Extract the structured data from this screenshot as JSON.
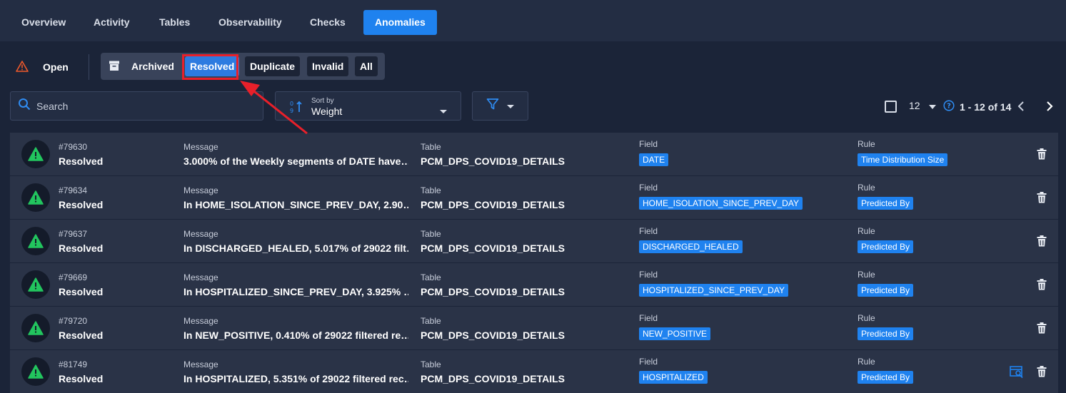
{
  "tabs": [
    {
      "label": "Overview",
      "active": false
    },
    {
      "label": "Activity",
      "active": false
    },
    {
      "label": "Tables",
      "active": false
    },
    {
      "label": "Observability",
      "active": false
    },
    {
      "label": "Checks",
      "active": false
    },
    {
      "label": "Anomalies",
      "active": true
    }
  ],
  "status_filter": {
    "open_label": "Open",
    "open_icon": "warning-triangle-outline-icon",
    "archived_label": "Archived",
    "archived_icon": "archive-box-icon",
    "options": [
      "Resolved",
      "Duplicate",
      "Invalid",
      "All"
    ],
    "selected": "Resolved"
  },
  "search": {
    "placeholder": "Search"
  },
  "sort": {
    "label": "Sort by",
    "value": "Weight"
  },
  "pagination": {
    "page_size": "12",
    "range": "1 - 12 of 14"
  },
  "columns": {
    "message": "Message",
    "table": "Table",
    "field": "Field",
    "rule": "Rule"
  },
  "rows": [
    {
      "id": "#79630",
      "status": "Resolved",
      "message": "3.000% of the Weekly segments of DATE have…",
      "table": "PCM_DPS_COVID19_DETAILS",
      "field": "DATE",
      "rule": "Time Distribution Size",
      "inspect": false
    },
    {
      "id": "#79634",
      "status": "Resolved",
      "message": "In HOME_ISOLATION_SINCE_PREV_DAY, 2.90…",
      "table": "PCM_DPS_COVID19_DETAILS",
      "field": "HOME_ISOLATION_SINCE_PREV_DAY",
      "rule": "Predicted By",
      "inspect": false
    },
    {
      "id": "#79637",
      "status": "Resolved",
      "message": "In DISCHARGED_HEALED, 5.017% of 29022 filt…",
      "table": "PCM_DPS_COVID19_DETAILS",
      "field": "DISCHARGED_HEALED",
      "rule": "Predicted By",
      "inspect": false
    },
    {
      "id": "#79669",
      "status": "Resolved",
      "message": "In HOSPITALIZED_SINCE_PREV_DAY, 3.925% …",
      "table": "PCM_DPS_COVID19_DETAILS",
      "field": "HOSPITALIZED_SINCE_PREV_DAY",
      "rule": "Predicted By",
      "inspect": false
    },
    {
      "id": "#79720",
      "status": "Resolved",
      "message": "In NEW_POSITIVE, 0.410% of 29022 filtered re…",
      "table": "PCM_DPS_COVID19_DETAILS",
      "field": "NEW_POSITIVE",
      "rule": "Predicted By",
      "inspect": false
    },
    {
      "id": "#81749",
      "status": "Resolved",
      "message": "In HOSPITALIZED, 5.351% of 29022 filtered rec…",
      "table": "PCM_DPS_COVID19_DETAILS",
      "field": "HOSPITALIZED",
      "rule": "Predicted By",
      "inspect": true
    }
  ],
  "colors": {
    "accent": "#1f82ef",
    "background": "#1b2438",
    "row": "#2a3347",
    "warning_green": "#22c55e",
    "open_orange": "#f0592a",
    "annotation_red": "#e8202a"
  }
}
